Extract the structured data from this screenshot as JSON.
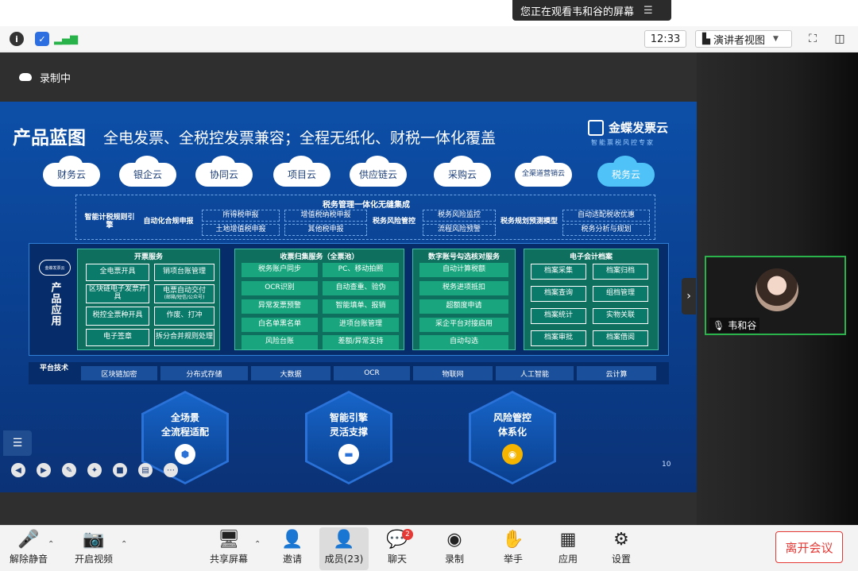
{
  "banner": {
    "text": "您正在观看韦和谷的屏幕"
  },
  "toolbar": {
    "time": "12:33",
    "view_mode": "演讲者视图"
  },
  "recording": {
    "label": "录制中"
  },
  "slide": {
    "title": "产品蓝图",
    "subtitle": "全电发票、全税控发票兼容；全程无纸化、财税一体化覆盖",
    "brand_name": "金蝶发票云",
    "brand_tagline": "智能票税风控专家",
    "clouds": [
      "财务云",
      "银企云",
      "协同云",
      "项目云",
      "供应链云",
      "采购云",
      "全渠道营销云",
      "税务云"
    ],
    "tax_integration_title": "税务管理一体化无缝集成",
    "tax_items": [
      "智能计税规则引擎",
      "自动化合规申报",
      "所得税申报",
      "增值税纳税申报",
      "土地增值税申报",
      "其他税申报",
      "税务风险管控",
      "税务风险监控",
      "流程风险预警",
      "税务规划预测模型",
      "自动适配税收优惠",
      "税务分析与规划"
    ],
    "app_label": "产品应用",
    "app_cloud_label": "金蝶发票云",
    "invoice_panel": {
      "title": "开票服务",
      "cells": [
        "全电票开具",
        "销项台账管理",
        "区块链电子发票开具",
        "电票自动交付",
        "(邮箱/短信/公众号)",
        "税控全票种开具",
        "作废、打冲",
        "电子签章",
        "拆分合并规则处理"
      ]
    },
    "collect_panel": {
      "title": "收票归集服务（全票池）",
      "cells": [
        "税务账户同步",
        "PC、移动拍照",
        "OCR识别",
        "自动查重、验伪",
        "异常发票预警",
        "智能填单、报销",
        "白名单黑名单",
        "进项台账管理",
        "风险台账",
        "差额/异常支持"
      ]
    },
    "digital_panel": {
      "title": "数字账号勾选核对服务",
      "cells": [
        "自动计算税额",
        "税务进项抵扣",
        "超额度申请",
        "采企平台对接启用",
        "自动勾选"
      ]
    },
    "archive_panel": {
      "title": "电子会计档案",
      "cells": [
        "档案采集",
        "档案归档",
        "档案查询",
        "组档管理",
        "档案统计",
        "实物关联",
        "档案审批",
        "档案借阅"
      ]
    },
    "platform_label": "平台技术",
    "platform_items": [
      "区块链加密",
      "分布式存储",
      "大数据",
      "OCR",
      "物联网",
      "人工智能",
      "云计算"
    ],
    "hex_cards": [
      {
        "line1": "全场景",
        "line2": "全流程适配"
      },
      {
        "line1": "智能引擎",
        "line2": "灵活支撑"
      },
      {
        "line1": "风险管控",
        "line2": "体系化"
      }
    ],
    "page_number": "10"
  },
  "participant": {
    "name": "韦和谷"
  },
  "bottom_bar": {
    "mute": "解除静音",
    "video": "开启视频",
    "share": "共享屏幕",
    "invite": "邀请",
    "members": "成员(23)",
    "chat": "聊天",
    "chat_badge": "2",
    "record": "录制",
    "raise_hand": "举手",
    "apps": "应用",
    "settings": "设置",
    "leave": "离开会议"
  },
  "colors": {
    "slide_bg": "#0d4fa8",
    "panel_green": "#0e6f5e",
    "active_speaker": "#29b34a",
    "leave_red": "#e53935"
  }
}
